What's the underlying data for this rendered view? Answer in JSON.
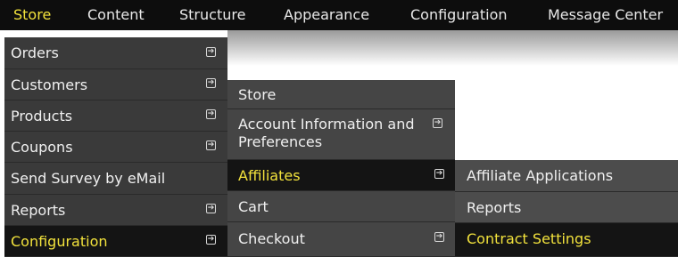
{
  "topnav": {
    "items": [
      "Store",
      "Content",
      "Structure",
      "Appearance",
      "Configuration",
      "Message Center"
    ],
    "active_index": 0
  },
  "store_menu": {
    "items": [
      {
        "label": "Orders",
        "has_submenu": true
      },
      {
        "label": "Customers",
        "has_submenu": true
      },
      {
        "label": "Products",
        "has_submenu": true
      },
      {
        "label": "Coupons",
        "has_submenu": true
      },
      {
        "label": "Send Survey by eMail",
        "has_submenu": false
      },
      {
        "label": "Reports",
        "has_submenu": true
      },
      {
        "label": "Configuration",
        "has_submenu": true,
        "active": true
      }
    ]
  },
  "configuration_menu": {
    "items": [
      {
        "label": "Store",
        "has_submenu": false
      },
      {
        "label": "Account Information and Preferences",
        "has_submenu": true
      },
      {
        "label": "Affiliates",
        "has_submenu": true,
        "active": true
      },
      {
        "label": "Cart",
        "has_submenu": false
      },
      {
        "label": "Checkout",
        "has_submenu": true
      }
    ]
  },
  "affiliates_menu": {
    "items": [
      {
        "label": "Affiliate Applications"
      },
      {
        "label": "Reports"
      },
      {
        "label": "Contract Settings",
        "active": true
      }
    ]
  },
  "colors": {
    "topbar_bg": "#0d0d0d",
    "active_text": "#f2e23c",
    "menu_text": "#f0f0f0",
    "menu_bg": "#3a3a3a",
    "active_bg": "#141414"
  },
  "icons": {
    "submenu_arrow": "arrow-right-box-icon"
  }
}
